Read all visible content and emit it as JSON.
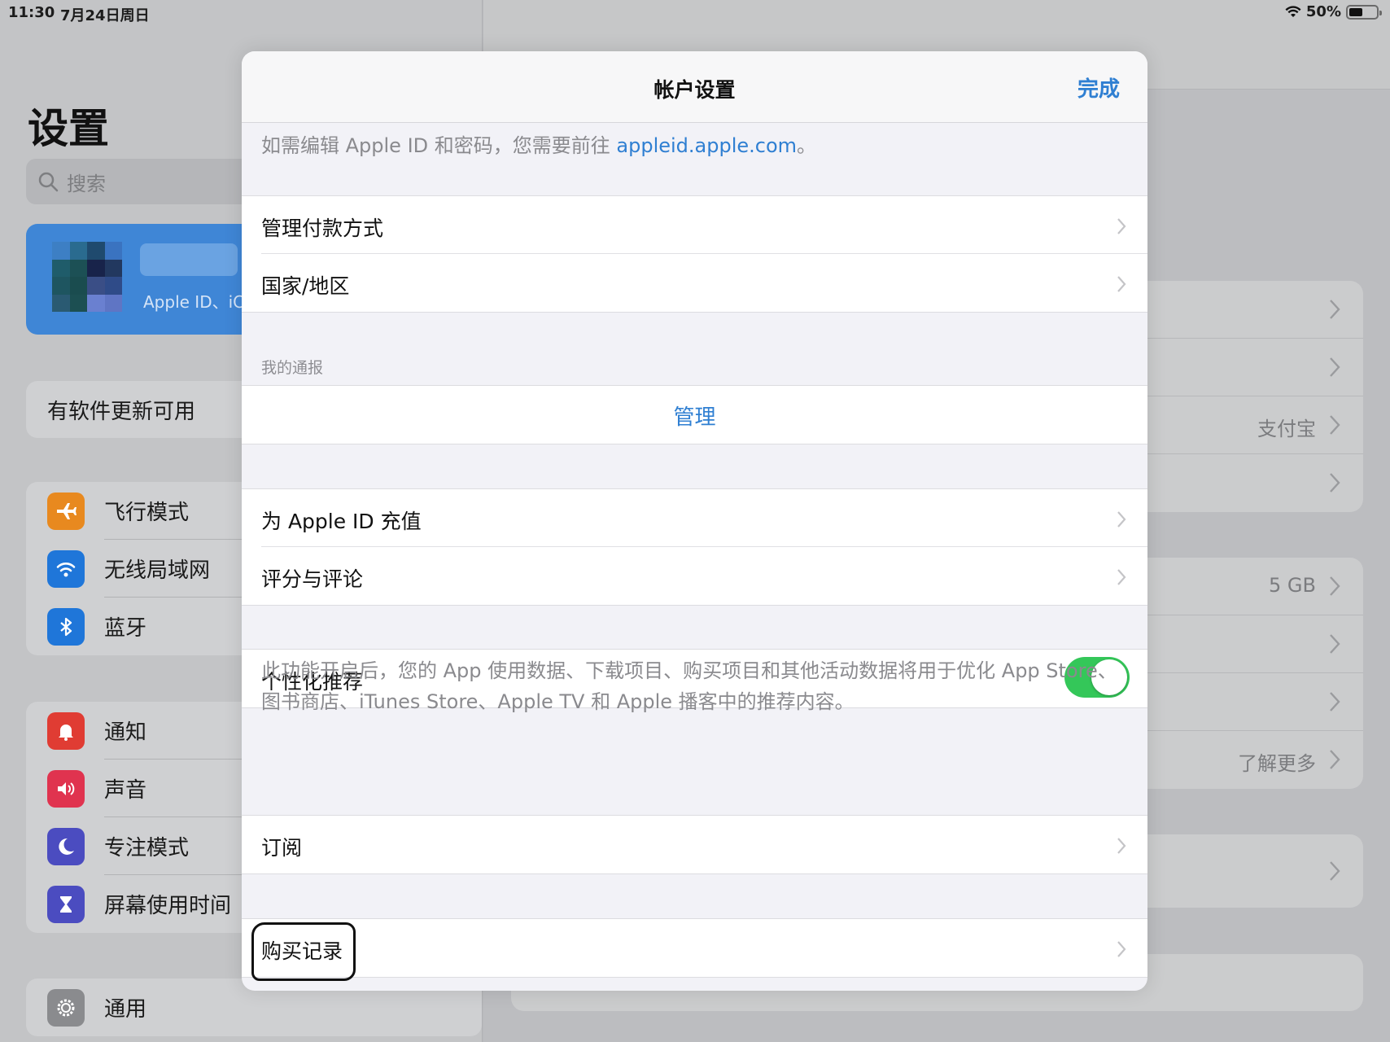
{
  "status_bar": {
    "time": "11:30",
    "date": "7月24日周日",
    "battery_percent": "50%",
    "battery_level": 0.5
  },
  "sidebar": {
    "title": "设置",
    "search_placeholder": "搜索",
    "profile_subtitle": "Apple ID、iC",
    "update_banner": "有软件更新可用",
    "groups": [
      [
        {
          "label": "飞行模式",
          "icon": "airplane-icon",
          "color": "#e8891f"
        },
        {
          "label": "无线局域网",
          "icon": "wifi-icon",
          "color": "#1f76d9"
        },
        {
          "label": "蓝牙",
          "icon": "bluetooth-icon",
          "color": "#1f76d9"
        }
      ],
      [
        {
          "label": "通知",
          "icon": "bell-icon",
          "color": "#e03c33"
        },
        {
          "label": "声音",
          "icon": "speaker-icon",
          "color": "#e0334f"
        },
        {
          "label": "专注模式",
          "icon": "moon-icon",
          "color": "#4b4cc0"
        },
        {
          "label": "屏幕使用时间",
          "icon": "hourglass-icon",
          "color": "#4b4cc0"
        }
      ],
      [
        {
          "label": "通用",
          "icon": "gear-icon",
          "color": "#8a8b8e"
        }
      ]
    ]
  },
  "detail_background": {
    "group1": [
      {
        "value": ""
      },
      {
        "value": ""
      },
      {
        "value": "支付宝"
      },
      {
        "value": ""
      }
    ],
    "group2": [
      {
        "value": "5 GB"
      },
      {
        "value": ""
      },
      {
        "value": ""
      },
      {
        "value": "了解更多"
      }
    ]
  },
  "modal": {
    "title": "帐户设置",
    "done_label": "完成",
    "info_prefix": "如需编辑 Apple ID 和密码，您需要前往 ",
    "info_link": "appleid.apple.com",
    "info_suffix": "。",
    "group1": [
      {
        "label": "管理付款方式"
      },
      {
        "label": "国家/地区"
      }
    ],
    "my_reports_header": "我的通报",
    "manage_label": "管理",
    "group2": [
      {
        "label": "为 Apple ID 充值"
      },
      {
        "label": "评分与评论"
      }
    ],
    "personalized": {
      "label": "个性化推荐",
      "enabled": true,
      "description": "此功能开启后，您的 App 使用数据、下载项目、购买项目和其他活动数据将用于优化 App Store、图书商店、iTunes Store、Apple TV 和 Apple 播客中的推荐内容。"
    },
    "subscriptions_label": "订阅",
    "purchase_history_label": "购买记录"
  },
  "colors": {
    "accent": "#2f7fd2",
    "toggle_on": "#34c759"
  }
}
